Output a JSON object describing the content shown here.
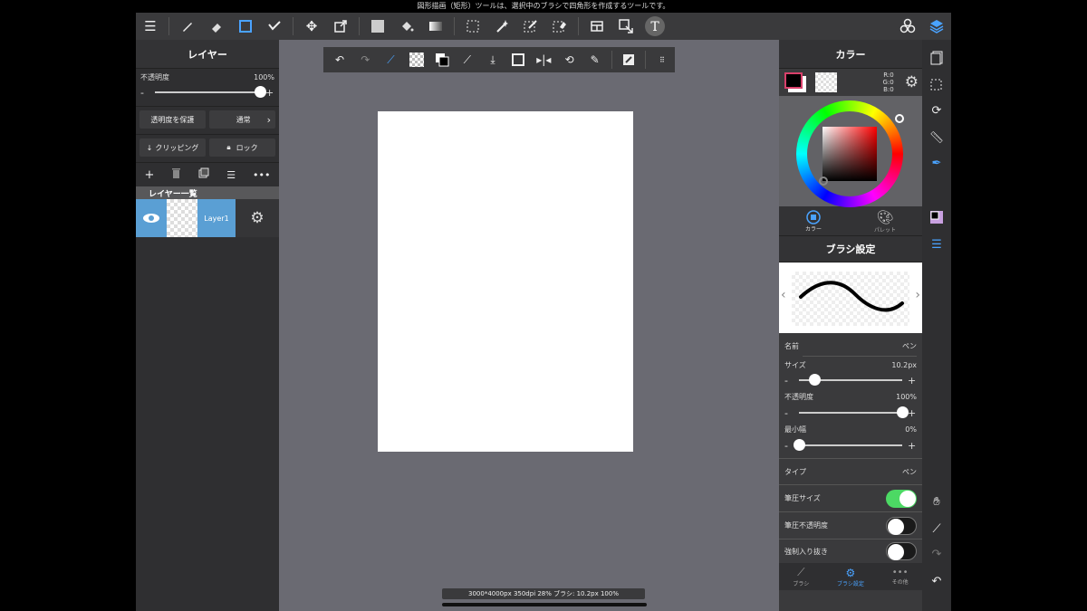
{
  "tooltip": "図形描画（矩形）ツールは、選択中のブラシで四角形を作成するツールです。",
  "toolbar": {
    "icons": [
      "menu-icon",
      "brush-icon",
      "eraser-icon",
      "rect-tool-icon",
      "stabilizer-icon",
      "move-icon",
      "transform-icon",
      "fill-color-icon",
      "bucket-icon",
      "gradient-icon",
      "select-rect-icon",
      "magic-wand-icon",
      "select-pen-icon",
      "select-eraser-icon",
      "panel-layout-icon",
      "select-move-icon",
      "text-tool-icon",
      "materials-icon",
      "layers-icon"
    ]
  },
  "layers_panel": {
    "title": "レイヤー",
    "opacity_label": "不透明度",
    "opacity_value": "100%",
    "opacity_level": 1.0,
    "protect_alpha": "透明度を保護",
    "blend_mode": "通常",
    "clipping": "クリッピング",
    "lock": "ロック",
    "list_title": "レイヤー一覧",
    "layers": [
      {
        "name": "Layer1"
      }
    ]
  },
  "status": "3000*4000px 350dpi 28% ブラシ: 10.2px 100%",
  "color_panel": {
    "title": "カラー",
    "rgb": {
      "r": "R:0",
      "g": "G:0",
      "b": "B:0"
    },
    "tabs": [
      {
        "label": "カラー"
      },
      {
        "label": "パレット"
      }
    ]
  },
  "brush_panel": {
    "title": "ブラシ設定",
    "name_label": "名前",
    "name_value": "ペン",
    "size_label": "サイズ",
    "size_value": "10.2px",
    "size_level": 0.15,
    "opacity_label": "不透明度",
    "opacity_value": "100%",
    "opacity_level": 1.0,
    "min_label": "最小幅",
    "min_value": "0%",
    "min_level": 0.0,
    "type_label": "タイプ",
    "type_value": "ペン",
    "pressure_size": "筆圧サイズ",
    "pressure_size_on": true,
    "pressure_opacity": "筆圧不透明度",
    "pressure_opacity_on": false,
    "forced_taper": "強制入り抜き",
    "forced_taper_on": false
  },
  "bottom_tabs": [
    {
      "label": "ブラシ"
    },
    {
      "label": "ブラシ設定"
    },
    {
      "label": "その他"
    }
  ],
  "colors": {
    "accent": "#4aa3ff",
    "toggle_on": "#4cd964",
    "layer_selected": "#5a9fd4"
  }
}
